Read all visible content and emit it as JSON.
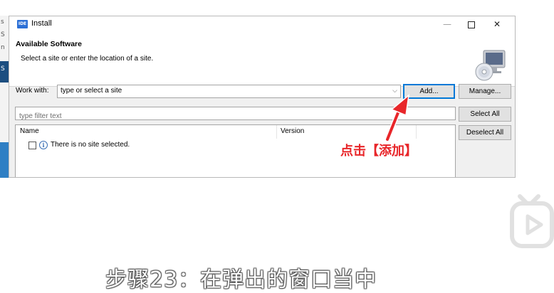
{
  "window": {
    "app_icon_text": "IDE",
    "title": "Install",
    "minimize_glyph": "—",
    "close_glyph": "✕"
  },
  "header": {
    "title": "Available Software",
    "subtitle": "Select a site or enter the location of a site."
  },
  "work_with": {
    "label": "Work with:",
    "value": "type or select a site",
    "dropdown_glyph": "⌵"
  },
  "buttons": {
    "add": "Add...",
    "manage": "Manage...",
    "select_all": "Select All",
    "deselect_all": "Deselect All"
  },
  "filter": {
    "placeholder": "type filter text"
  },
  "table": {
    "columns": [
      "Name",
      "Version"
    ],
    "rows": [
      {
        "info_glyph": "i",
        "text": "There is no site selected."
      }
    ]
  },
  "annotation": {
    "text": "点击【添加】",
    "color": "#e8262a"
  },
  "caption": "步骤23：在弹出的窗口当中",
  "background_letters": [
    "s",
    "S",
    "n",
    "S"
  ]
}
